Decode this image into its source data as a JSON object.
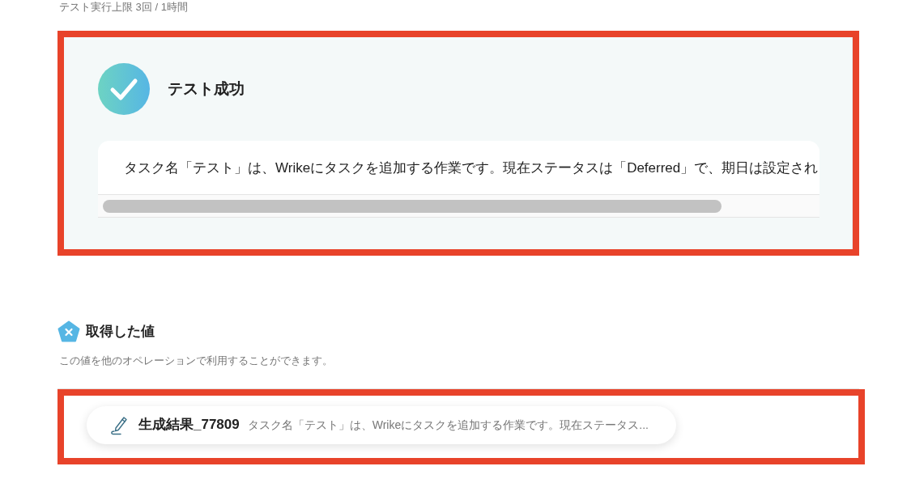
{
  "limit_note": "テスト実行上限 3回 / 1時間",
  "result": {
    "succeeded": true,
    "title": "テスト成功",
    "output": "タスク名「テスト」は、Wrikeにタスクを追加する作業です。現在ステータスは「Deferred」で、期日は設定され"
  },
  "values_section": {
    "title": "取得した値",
    "description": "この値を他のオペレーションで利用することができます。",
    "values": [
      {
        "name": "生成結果_77809",
        "preview": "タスク名「テスト」は、Wrikeにタスクを追加する作業です。現在ステータス..."
      }
    ]
  }
}
